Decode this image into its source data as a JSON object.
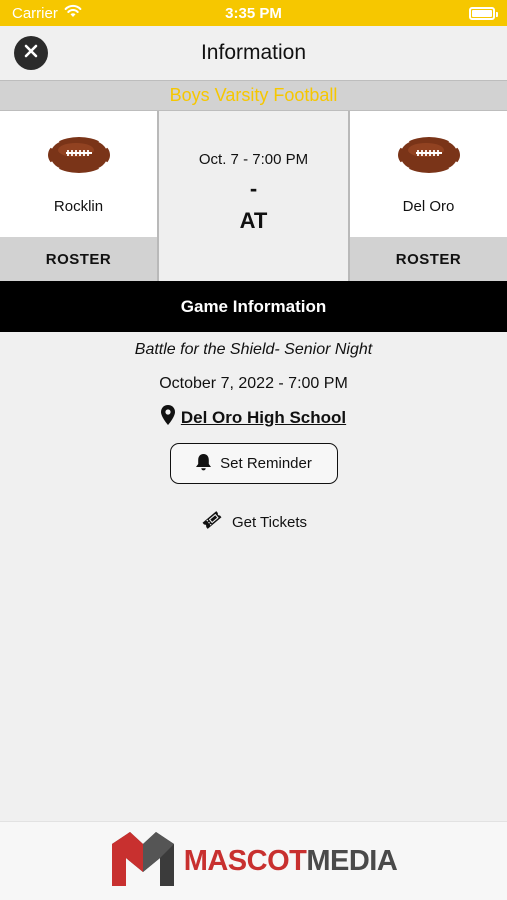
{
  "status_bar": {
    "carrier": "Carrier",
    "time": "3:35 PM"
  },
  "nav": {
    "title": "Information"
  },
  "game": {
    "sport_title": "Boys Varsity Football",
    "home_team": {
      "name": "Rocklin",
      "roster_label": "ROSTER"
    },
    "away_team": {
      "name": "Del Oro",
      "roster_label": "ROSTER"
    },
    "short_datetime": "Oct. 7 - 7:00 PM",
    "score": "-",
    "versus": "AT"
  },
  "info": {
    "header": "Game Information",
    "description": "Battle for the Shield- Senior Night",
    "datetime": "October 7, 2022 - 7:00 PM",
    "location": "Del Oro High School",
    "reminder_label": "Set Reminder",
    "tickets_label": "Get Tickets"
  },
  "footer": {
    "brand_part1": "MASCOT",
    "brand_part2": "MEDIA"
  },
  "colors": {
    "accent": "#f6c700",
    "black": "#000000",
    "gray": "#d2d2d2",
    "brand_red": "#c8302f",
    "brand_gray": "#4a4a4a"
  },
  "icons": [
    "wifi-icon",
    "battery-icon",
    "close-icon",
    "football-icon",
    "location-pin-icon",
    "bell-icon",
    "ticket-icon",
    "mascot-media-logo"
  ]
}
